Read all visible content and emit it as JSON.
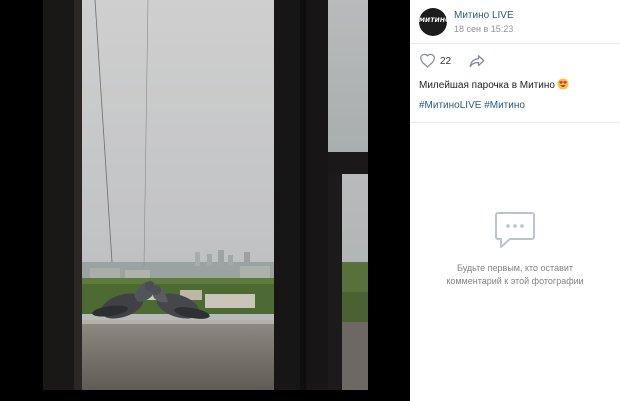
{
  "photo": {
    "description_icon": "photo-window-pigeons"
  },
  "post": {
    "author_name": "Митино LIVE",
    "avatar_text": "МИТИНО",
    "date": "18 сен в 15:23",
    "likes_count": "22",
    "caption": "Милейшая парочка в Митино",
    "hashtags": [
      "#МитиноLIVE",
      "#Митино"
    ]
  },
  "comments": {
    "empty_line_1": "Будьте первым, кто оставит",
    "empty_line_2": "комментарий к этой фотографии"
  },
  "colors": {
    "link": "#2a5885",
    "muted": "#939393",
    "divider": "#e7e8ec",
    "icon_gray": "#b9c4d0"
  }
}
